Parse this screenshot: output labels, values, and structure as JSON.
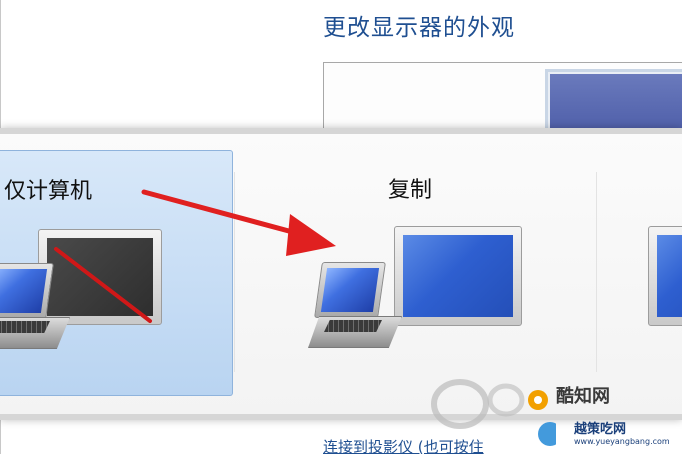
{
  "background_window": {
    "title": "更改显示器的外观",
    "link_text": "连接到投影仪 (也可按住"
  },
  "projector_switcher": {
    "options": [
      {
        "id": "computer-only",
        "label": "仅计算机",
        "selected": true,
        "icon": "monitor-off-with-laptop-icon"
      },
      {
        "id": "duplicate",
        "label": "复制",
        "selected": false,
        "icon": "monitor-laptop-icon"
      },
      {
        "id": "extend",
        "label": "",
        "selected": false,
        "icon": "monitor-icon"
      }
    ]
  },
  "annotation": {
    "icon": "red-arrow-icon",
    "color": "#e02020"
  },
  "watermark": {
    "title": "酷知网",
    "brand": "越策吃网",
    "url": "www.yueyangbang.com"
  },
  "colors": {
    "title_blue": "#1f4f91",
    "selected_bg": "#c7dcf4",
    "screen_blue": "#2e5fd0"
  }
}
